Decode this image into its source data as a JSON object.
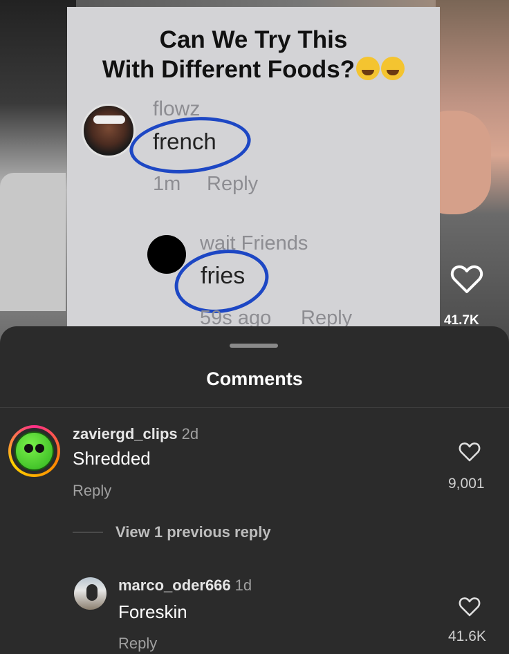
{
  "video": {
    "overlay": {
      "title_line1": "Can We Try This",
      "title_line2": "With Different Foods?",
      "title_emojis": [
        "grinning-sweat-emoji",
        "rofl-emoji"
      ],
      "comment1": {
        "username": "flowz",
        "word": "french",
        "time": "1m",
        "reply": "Reply"
      },
      "comment2": {
        "username": "wait  Friends",
        "word": "fries",
        "time": "59s ago",
        "reply": "Reply"
      },
      "highlight_color": "#1d47c4"
    },
    "like_icon": "heart-icon",
    "like_count": "41.7K"
  },
  "comments_sheet": {
    "title": "Comments",
    "comments": [
      {
        "username": "zaviergd_clips",
        "time": "2d",
        "text": "Shredded",
        "reply_label": "Reply",
        "like_count": "9,001",
        "avatar_icon": "green-smiley-avatar"
      }
    ],
    "view_previous": "View 1 previous reply",
    "replies": [
      {
        "username": "marco_oder666",
        "time": "1d",
        "text": "Foreskin",
        "reply_label": "Reply",
        "like_count": "41.6K"
      }
    ],
    "colors": {
      "sheet_bg": "#2b2b2b",
      "text": "#ffffff",
      "muted": "#a0a0a0"
    }
  }
}
